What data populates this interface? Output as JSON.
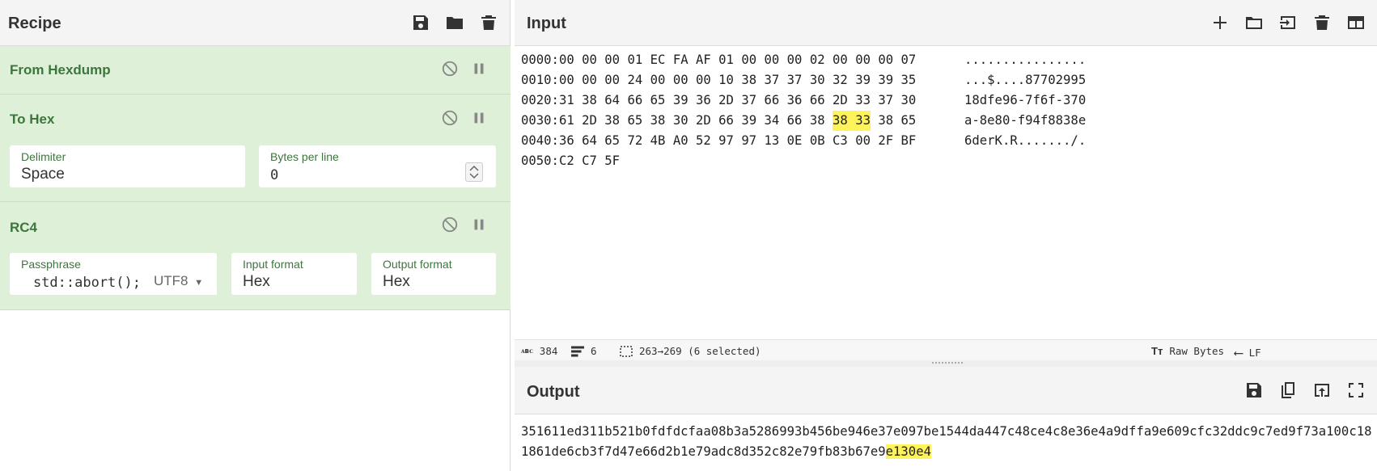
{
  "recipe": {
    "title": "Recipe",
    "icons": [
      "save-icon",
      "folder-icon",
      "trash-icon"
    ],
    "operations": [
      {
        "name": "From Hexdump"
      },
      {
        "name": "To Hex",
        "args": {
          "delimiter_label": "Delimiter",
          "delimiter_value": "Space",
          "bytes_label": "Bytes per line",
          "bytes_value": "0"
        }
      },
      {
        "name": "RC4",
        "args": {
          "passphrase_label": "Passphrase",
          "passphrase_value": "std::abort();",
          "passphrase_encoding": "UTF8",
          "input_format_label": "Input format",
          "input_format_value": "Hex",
          "output_format_label": "Output format",
          "output_format_value": "Hex"
        }
      }
    ]
  },
  "input": {
    "title": "Input",
    "icons": [
      "add-icon",
      "folder-icon",
      "import-icon",
      "trash-icon",
      "layout-icon"
    ],
    "hexdump": [
      {
        "offset": "0000:",
        "bytes": [
          "00",
          "00",
          "00",
          "01",
          "EC",
          "FA",
          "AF",
          "01",
          "00",
          "00",
          "00",
          "02",
          "00",
          "00",
          "00",
          "07"
        ],
        "ascii": "................"
      },
      {
        "offset": "0010:",
        "bytes": [
          "00",
          "00",
          "00",
          "24",
          "00",
          "00",
          "00",
          "10",
          "38",
          "37",
          "37",
          "30",
          "32",
          "39",
          "39",
          "35"
        ],
        "ascii": "...$....87702995"
      },
      {
        "offset": "0020:",
        "bytes": [
          "31",
          "38",
          "64",
          "66",
          "65",
          "39",
          "36",
          "2D",
          "37",
          "66",
          "36",
          "66",
          "2D",
          "33",
          "37",
          "30"
        ],
        "ascii": "18dfe96-7f6f-370"
      },
      {
        "offset": "0030:",
        "bytes": [
          "61",
          "2D",
          "38",
          "65",
          "38",
          "30",
          "2D",
          "66",
          "39",
          "34",
          "66",
          "38",
          "38",
          "33",
          "38",
          "65"
        ],
        "ascii": "a-8e80-f94f8838e"
      },
      {
        "offset": "0040:",
        "bytes": [
          "36",
          "64",
          "65",
          "72",
          "4B",
          "A0",
          "52",
          "97",
          "97",
          "13",
          "0E",
          "0B",
          "C3",
          "00",
          "2F",
          "BF"
        ],
        "ascii": "6derK.R......./."
      },
      {
        "offset": "0050:",
        "bytes": [
          "C2",
          "C7",
          "5F"
        ],
        "ascii": ""
      }
    ],
    "highlight": {
      "row": 3,
      "bytes": [
        12,
        13
      ]
    },
    "status": {
      "chars": "384",
      "lines": "6",
      "selection": "263→269 (6 selected)",
      "encoding": "Raw Bytes",
      "eol": "LF"
    }
  },
  "output": {
    "title": "Output",
    "icons": [
      "save-icon",
      "copy-icon",
      "replace-input-icon",
      "maximise-icon"
    ],
    "text_plain": "351611ed311b521b0fdfdcfaa08b3a5286993b456be946e37e097be1544da447c48ce4c8e36e4a9dffa9e609cfc32ddc9c7ed9f73a100c181861de6cb3f7d47e66d2b1e79adc8d352c82e79fb83b67e9",
    "text_highlight": "e130e4"
  },
  "colors": {
    "op_bg": "#dff0d8",
    "op_text": "#3c763d",
    "highlight": "#fff35c"
  }
}
